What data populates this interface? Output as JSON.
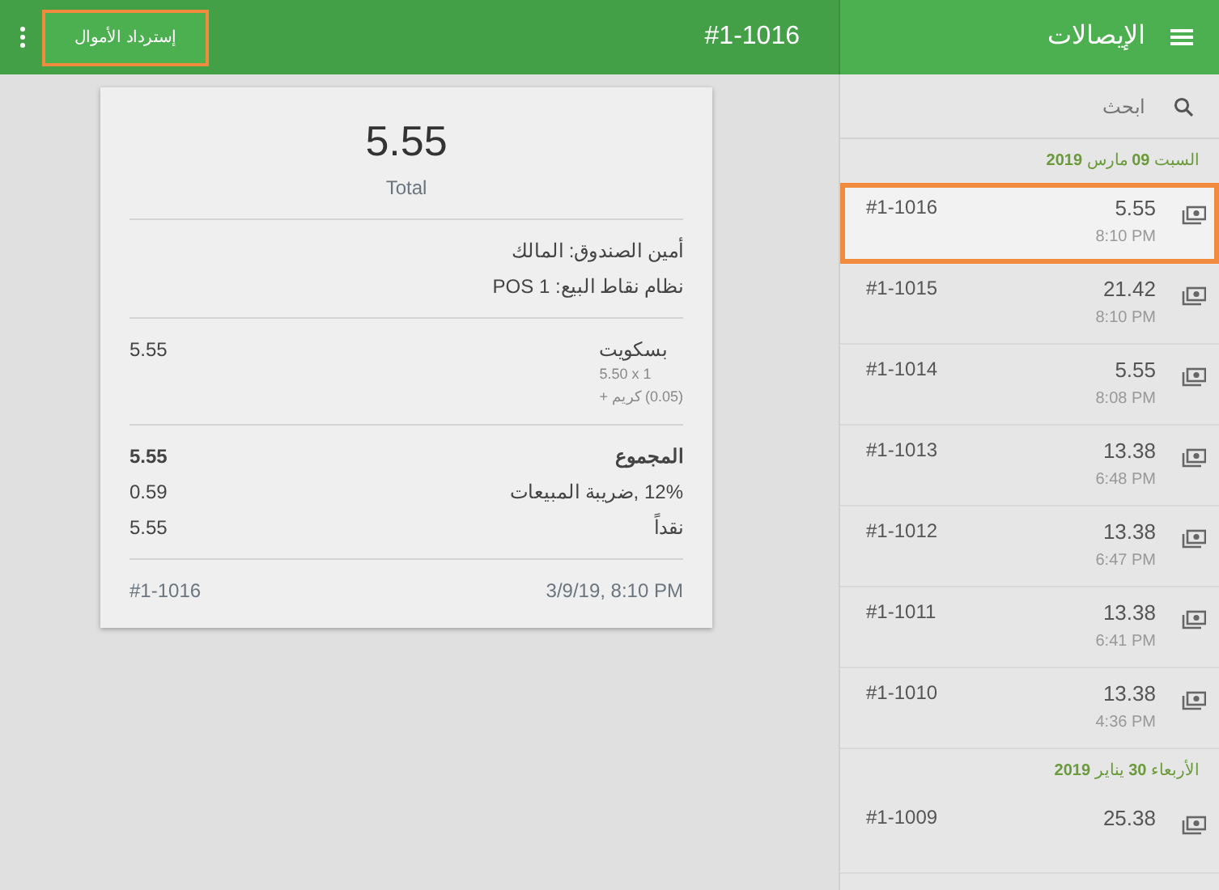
{
  "sidebar": {
    "title": "الإيصالات",
    "search": {
      "placeholder": "ابحث"
    },
    "groups": [
      {
        "date": "السبت **09** مارس **2019**",
        "receipts": [
          {
            "number": "#1-1016",
            "amount": "5.55",
            "time": "8:10 PM",
            "selected": true,
            "highlighted": true
          },
          {
            "number": "#1-1015",
            "amount": "21.42",
            "time": "8:10 PM",
            "selected": false,
            "highlighted": false
          },
          {
            "number": "#1-1014",
            "amount": "5.55",
            "time": "8:08 PM",
            "selected": false,
            "highlighted": false
          },
          {
            "number": "#1-1013",
            "amount": "13.38",
            "time": "6:48 PM",
            "selected": false,
            "highlighted": false
          },
          {
            "number": "#1-1012",
            "amount": "13.38",
            "time": "6:47 PM",
            "selected": false,
            "highlighted": false
          },
          {
            "number": "#1-1011",
            "amount": "13.38",
            "time": "6:41 PM",
            "selected": false,
            "highlighted": false
          },
          {
            "number": "#1-1010",
            "amount": "13.38",
            "time": "4:36 PM",
            "selected": false,
            "highlighted": false
          }
        ]
      },
      {
        "date": "الأربعاء **30** يناير **2019**",
        "receipts": [
          {
            "number": "#1-1009",
            "amount": "25.38",
            "selected": false,
            "highlighted": false
          }
        ]
      }
    ]
  },
  "header": {
    "title": "#1-1016",
    "refund_button": {
      "label": "إسترداد الأموال",
      "highlighted": true
    }
  },
  "receipt": {
    "total": "5.55",
    "total_label": "Total",
    "info": [
      "أمين الصندوق: المالك",
      "نظام نقاط البيع: POS 1"
    ],
    "items": [
      {
        "name": "بسكويت",
        "price": "5.55",
        "details": [
          "5.50 x 1",
          "(0.05) كريم +"
        ]
      }
    ],
    "summary": [
      {
        "label": "المجموع",
        "value": "5.55",
        "bold": true
      },
      {
        "label": "12% ,ضريبة المبيعات",
        "value": "0.59",
        "bold": false
      },
      {
        "label": "نقداً",
        "value": "5.55",
        "bold": false
      }
    ],
    "footer": {
      "number": "#1-1016",
      "date": "3/9/19, 8:10 PM"
    }
  }
}
